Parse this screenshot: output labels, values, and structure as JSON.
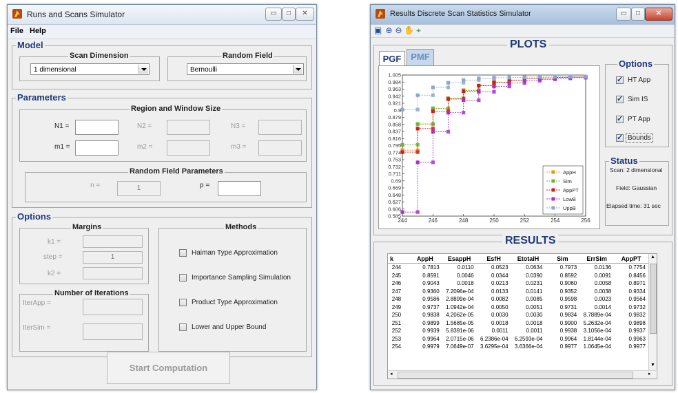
{
  "sim": {
    "title": "Runs and Scans Simulator",
    "menu": [
      "File",
      "Help"
    ],
    "model": {
      "title": "Model",
      "scan_dimension": {
        "label": "Scan Dimension",
        "value": "1 dimensional"
      },
      "random_field": {
        "label": "Random Field",
        "value": "Bernoulli"
      }
    },
    "parameters": {
      "title": "Parameters",
      "region": {
        "title": "Region and Window Size",
        "n1": "N1 =",
        "n2": "N2 =",
        "n3": "N3 =",
        "m1": "m1 =",
        "m2": "m2 =",
        "m3": "m3 ="
      },
      "rfp": {
        "title": "Random Field Parameters",
        "n_label": "n =",
        "n_value": "1",
        "p_label": "p ="
      }
    },
    "options": {
      "title": "Options",
      "margins": {
        "title": "Margins",
        "k1": "k1 =",
        "step": "step =",
        "step_value": "1",
        "k2": "k2 ="
      },
      "iterations": {
        "title": "Number of Iterations",
        "iterapp": "IterApp =",
        "itersim": "IterSim ="
      },
      "methods": {
        "title": "Methods",
        "items": [
          "Haiman Type Approximation",
          "Importance Sampling Simulation",
          "Product Type Approximation",
          "Lower and Upper Bound"
        ]
      }
    },
    "start_button": "Start Computation"
  },
  "res": {
    "title": "Results Discrete Scan Statistics Simulator",
    "toolbar_icons": [
      "save-icon",
      "zoom-in-icon",
      "zoom-out-icon",
      "pan-icon",
      "data-cursor-icon"
    ],
    "plots_title": "PLOTS",
    "tabs": [
      "PGF",
      "PMF"
    ],
    "options": {
      "title": "Options",
      "items": [
        {
          "label": "HT App",
          "checked": true
        },
        {
          "label": "Sim IS",
          "checked": true
        },
        {
          "label": "PT App",
          "checked": true
        },
        {
          "label": "Bounds",
          "checked": true
        }
      ]
    },
    "status": {
      "title": "Status",
      "scan": "Scan: 2 dimensional",
      "field": "Field: Gaussian",
      "elapsed": "Elapsed time: 31 sec"
    },
    "results_title": "RESULTS",
    "table": {
      "headers": [
        "k",
        "AppH",
        "EsappH",
        "EsfH",
        "EtotalH",
        "Sim",
        "ErrSim",
        "AppPT"
      ],
      "rows": [
        [
          "244",
          "0.7813",
          "0.0110",
          "0.0523",
          "0.0634",
          "0.7973",
          "0.0136",
          "0.7754"
        ],
        [
          "245",
          "0.8591",
          "0.0046",
          "0.0344",
          "0.0390",
          "0.8592",
          "0.0091",
          "0.8456"
        ],
        [
          "246",
          "0.9043",
          "0.0018",
          "0.0213",
          "0.0231",
          "0.9060",
          "0.0058",
          "0.8971"
        ],
        [
          "247",
          "0.9360",
          "7.2096e-04",
          "0.0133",
          "0.0141",
          "0.9352",
          "0.0038",
          "0.9334"
        ],
        [
          "248",
          "0.9586",
          "2.8899e-04",
          "0.0082",
          "0.0085",
          "0.9598",
          "0.0023",
          "0.9564"
        ],
        [
          "249",
          "0.9737",
          "1.0942e-04",
          "0.0050",
          "0.0051",
          "0.9731",
          "0.0014",
          "0.9732"
        ],
        [
          "250",
          "0.9838",
          "4.2062e-05",
          "0.0030",
          "0.0030",
          "0.9834",
          "8.7889e-04",
          "0.9832"
        ],
        [
          "251",
          "0.9899",
          "1.5685e-05",
          "0.0018",
          "0.0018",
          "0.9900",
          "5.2632e-04",
          "0.9898"
        ],
        [
          "252",
          "0.9939",
          "5.8391e-06",
          "0.0011",
          "0.0011",
          "0.9938",
          "3.1056e-04",
          "0.9937"
        ],
        [
          "253",
          "0.9964",
          "2.0715e-06",
          "6.2386e-04",
          "6.2593e-04",
          "0.9964",
          "1.8144e-04",
          "0.9963"
        ],
        [
          "254",
          "0.9979",
          "7.0649e-07",
          "3.6295e-04",
          "3.6366e-04",
          "0.9977",
          "1.0645e-04",
          "0.9977"
        ]
      ]
    }
  },
  "chart_data": {
    "type": "line",
    "step": true,
    "xlim": [
      244,
      256
    ],
    "ylim": [
      0.585,
      1.005
    ],
    "x_ticks": [
      244,
      246,
      248,
      250,
      252,
      254,
      256
    ],
    "y_ticks": [
      "1.005",
      "0.984",
      "0.963",
      "0.942",
      "0.921",
      "0.9",
      "0.879",
      "0.858",
      "0.837",
      "0.816",
      "0.795",
      "0.774",
      "0.753",
      "0.732",
      "0.711",
      "0.69",
      "0.669",
      "0.648",
      "0.627",
      "0.606",
      "0.585"
    ],
    "legend_position": "bottom-right",
    "x": [
      244,
      245,
      246,
      247,
      248,
      249,
      250,
      251,
      252,
      253,
      254,
      255,
      256
    ],
    "series": [
      {
        "name": "AppH",
        "color": "#e8961a",
        "dash": true,
        "values": [
          0.7813,
          0.8591,
          0.9043,
          0.936,
          0.9586,
          0.9737,
          0.9838,
          0.9899,
          0.9939,
          0.9964,
          0.9979,
          0.999,
          0.9995
        ]
      },
      {
        "name": "Sim",
        "color": "#6fb53a",
        "dash": true,
        "values": [
          0.7973,
          0.8592,
          0.906,
          0.9352,
          0.9598,
          0.9731,
          0.9834,
          0.99,
          0.9938,
          0.9964,
          0.9977,
          0.9988,
          0.9994
        ]
      },
      {
        "name": "AppPT",
        "color": "#d41c1c",
        "dash": true,
        "values": [
          0.7754,
          0.8456,
          0.8971,
          0.9334,
          0.9564,
          0.9732,
          0.9832,
          0.9898,
          0.9937,
          0.9963,
          0.9977,
          0.9987,
          0.9993
        ]
      },
      {
        "name": "LowB",
        "color": "#a832c8",
        "dash": true,
        "values": [
          0.597,
          0.745,
          0.836,
          0.893,
          0.93,
          0.955,
          0.971,
          0.981,
          0.988,
          0.992,
          0.995,
          0.997,
          0.998
        ]
      },
      {
        "name": "UppB",
        "color": "#8ea8c8",
        "dash": true,
        "values": [
          0.902,
          0.945,
          0.968,
          0.982,
          0.99,
          0.995,
          0.997,
          0.998,
          0.999,
          0.9995,
          1.0,
          1.0,
          1.0
        ]
      }
    ]
  }
}
